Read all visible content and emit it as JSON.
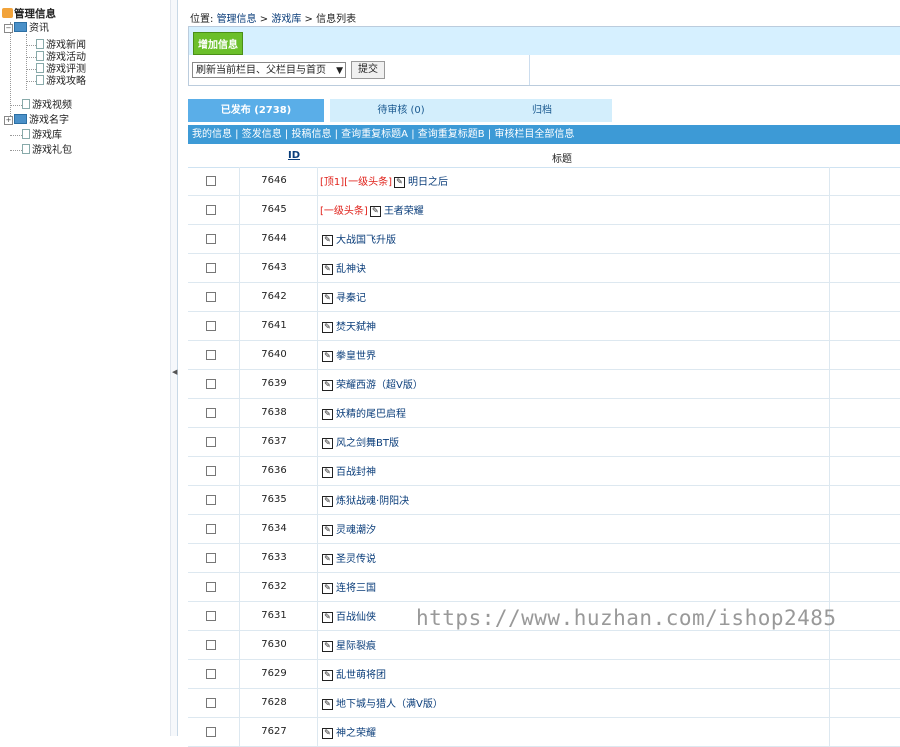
{
  "tree": {
    "root": "管理信息",
    "category_1": "资讯",
    "category_1_children": [
      "游戏新闻",
      "游戏活动",
      "游戏评测",
      "游戏攻略"
    ],
    "item_video": "游戏视频",
    "category_2": "游戏名字",
    "item_library": "游戏库",
    "item_gift": "游戏礼包"
  },
  "breadcrumb": {
    "prefix": "位置:",
    "part1": "管理信息",
    "sep1": ">",
    "part2": "游戏库",
    "sep2": ">",
    "part3": "信息列表"
  },
  "toolbar": {
    "add_button": "增加信息",
    "refresh_select": "刷新当前栏目、父栏目与首页",
    "submit_button": "提交"
  },
  "tabs": [
    {
      "label": "已发布 (2738)",
      "active": true
    },
    {
      "label": "待审核 (0)",
      "active": false
    },
    {
      "label": "归档",
      "active": false
    }
  ],
  "linkbar": {
    "text": "我的信息 | 签发信息 | 投稿信息 | 查询重复标题A | 查询重复标题B | 审核栏目全部信息"
  },
  "table": {
    "header_id": "ID",
    "header_title": "标题",
    "header_more": ":",
    "rows": [
      {
        "id": "7646",
        "tag": "[顶1][一级头条]",
        "title": "明日之后"
      },
      {
        "id": "7645",
        "tag": "[一级头条]",
        "title": "王者荣耀"
      },
      {
        "id": "7644",
        "tag": "",
        "title": "大战国飞升版"
      },
      {
        "id": "7643",
        "tag": "",
        "title": "乱神诀"
      },
      {
        "id": "7642",
        "tag": "",
        "title": "寻秦记"
      },
      {
        "id": "7641",
        "tag": "",
        "title": "焚天弑神"
      },
      {
        "id": "7640",
        "tag": "",
        "title": "拳皇世界"
      },
      {
        "id": "7639",
        "tag": "",
        "title": "荣耀西游（超V版）"
      },
      {
        "id": "7638",
        "tag": "",
        "title": "妖精的尾巴启程"
      },
      {
        "id": "7637",
        "tag": "",
        "title": "风之剑舞BT版"
      },
      {
        "id": "7636",
        "tag": "",
        "title": "百战封神"
      },
      {
        "id": "7635",
        "tag": "",
        "title": "炼狱战魂·阴阳决"
      },
      {
        "id": "7634",
        "tag": "",
        "title": "灵魂潮汐"
      },
      {
        "id": "7633",
        "tag": "",
        "title": "圣灵传说"
      },
      {
        "id": "7632",
        "tag": "",
        "title": "连将三国"
      },
      {
        "id": "7631",
        "tag": "",
        "title": "百战仙侠"
      },
      {
        "id": "7630",
        "tag": "",
        "title": "星际裂痕"
      },
      {
        "id": "7629",
        "tag": "",
        "title": "乱世萌将团"
      },
      {
        "id": "7628",
        "tag": "",
        "title": "地下城与猎人（满V版）"
      },
      {
        "id": "7627",
        "tag": "",
        "title": "神之荣耀"
      }
    ]
  },
  "watermark": "https://www.huzhan.com/ishop2485",
  "colors": {
    "accent_blue": "#3d9ad6",
    "tab_active": "#5aaee8",
    "tab_inactive": "#d3eefc",
    "add_button_green": "#6bbf2a",
    "tag_red": "#e0221b"
  }
}
